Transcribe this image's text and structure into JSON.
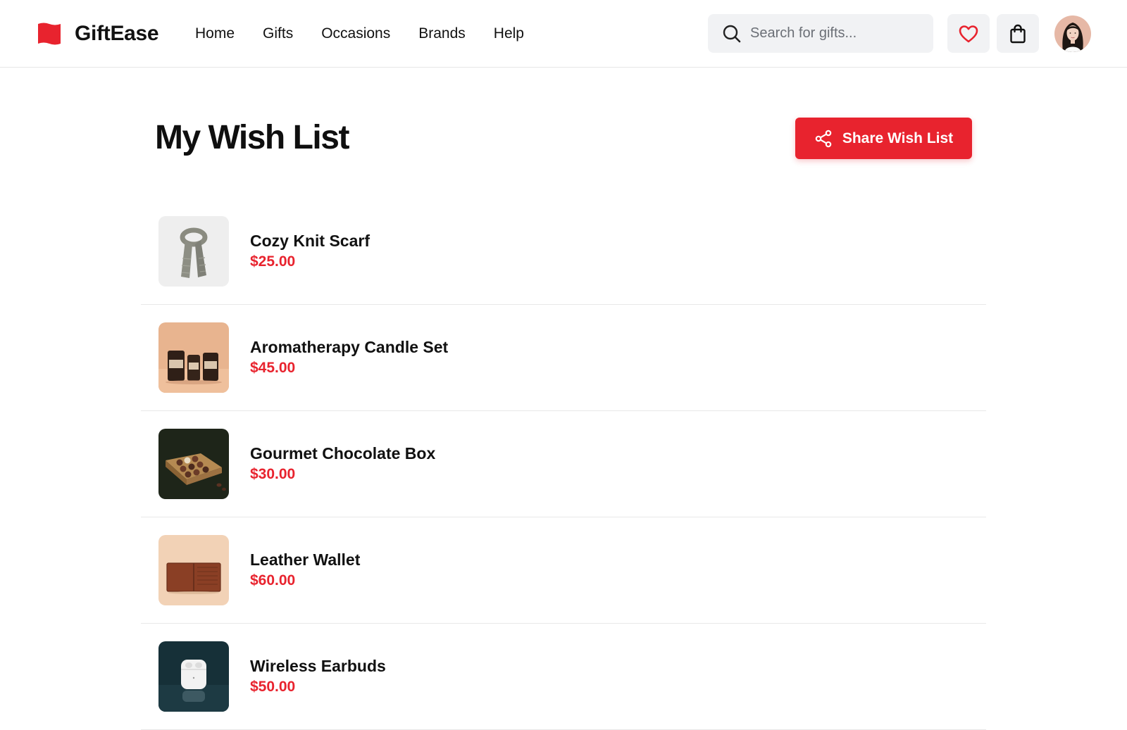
{
  "header": {
    "brand_name": "GiftEase",
    "brand_color": "#e8232e",
    "nav": [
      {
        "label": "Home"
      },
      {
        "label": "Gifts"
      },
      {
        "label": "Occasions"
      },
      {
        "label": "Brands"
      },
      {
        "label": "Help"
      }
    ],
    "search_placeholder": "Search for gifts...",
    "icons": [
      "search-icon",
      "heart-icon",
      "shopping-bag-icon"
    ]
  },
  "page": {
    "title": "My Wish List",
    "share_label": "Share Wish List",
    "accent_color": "#e8232e"
  },
  "items": [
    {
      "name": "Cozy Knit Scarf",
      "price": "$25.00",
      "image": "knit-scarf"
    },
    {
      "name": "Aromatherapy Candle Set",
      "price": "$45.00",
      "image": "candle-set"
    },
    {
      "name": "Gourmet Chocolate Box",
      "price": "$30.00",
      "image": "chocolate-box"
    },
    {
      "name": "Leather Wallet",
      "price": "$60.00",
      "image": "leather-wallet"
    },
    {
      "name": "Wireless Earbuds",
      "price": "$50.00",
      "image": "wireless-earbuds"
    }
  ]
}
